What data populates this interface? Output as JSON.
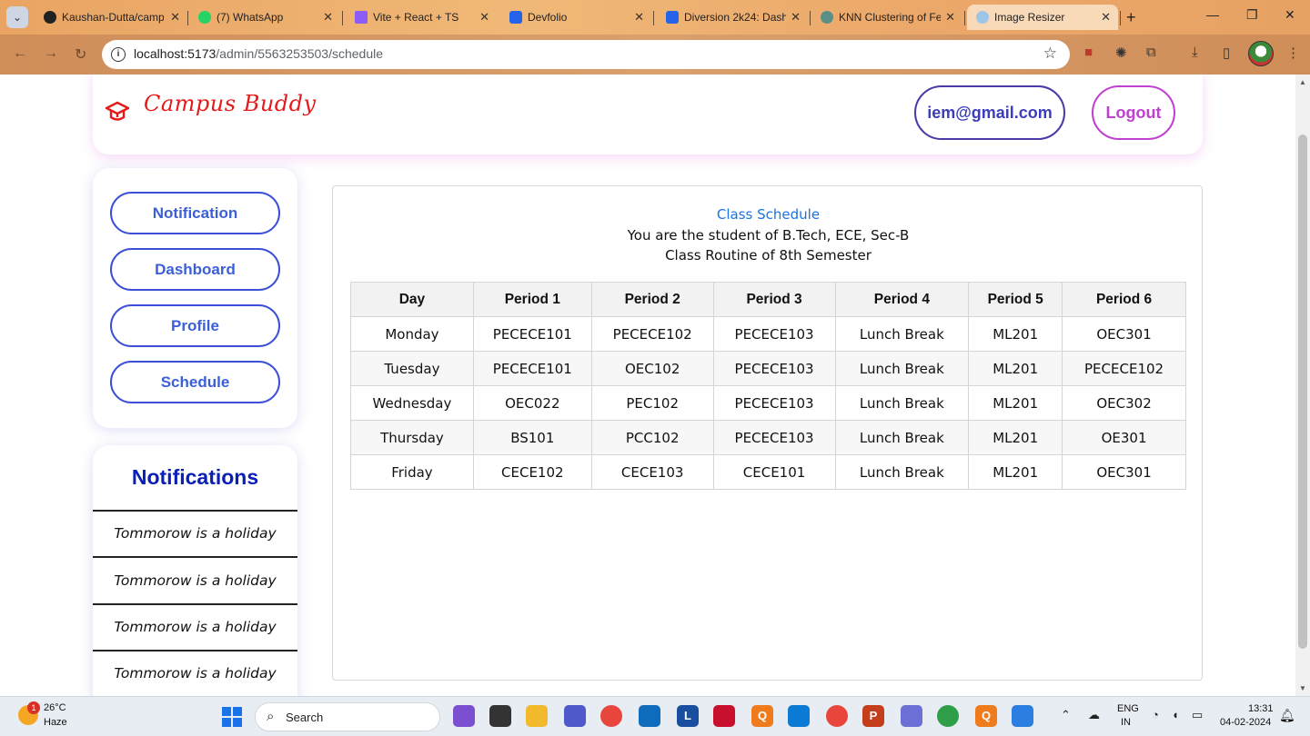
{
  "browser": {
    "tabs": [
      {
        "title": "Kaushan-Dutta/camp",
        "icon": "github-icon",
        "active": false
      },
      {
        "title": "(7) WhatsApp",
        "icon": "whatsapp-icon",
        "active": false
      },
      {
        "title": "Vite + React + TS",
        "icon": "vite-icon",
        "active": false
      },
      {
        "title": "Devfolio",
        "icon": "devfolio-icon",
        "active": false
      },
      {
        "title": "Diversion 2k24: Dash",
        "icon": "devfolio-icon",
        "active": false
      },
      {
        "title": "KNN Clustering of Fe",
        "icon": "openai-icon",
        "active": false
      },
      {
        "title": "Image Resizer",
        "icon": "globe-icon",
        "active": true
      }
    ],
    "url_host": "localhost:5173",
    "url_path": "/admin/5563253503/schedule"
  },
  "header": {
    "brand": "Campus Buddy",
    "email": "iem@gmail.com",
    "logout": "Logout",
    "brand_color": "#e51a1a"
  },
  "nav": {
    "items": [
      "Notification",
      "Dashboard",
      "Profile",
      "Schedule"
    ]
  },
  "notifications": {
    "title": "Notifications",
    "items": [
      "Tommorow is a holiday",
      "Tommorow is a holiday",
      "Tommorow is a holiday",
      "Tommorow is a holiday"
    ]
  },
  "schedule": {
    "title": "Class Schedule",
    "subtitle1": "You are the student of B.Tech, ECE, Sec-B",
    "subtitle2": "Class Routine of 8th Semester",
    "headers": [
      "Day",
      "Period 1",
      "Period 2",
      "Period 3",
      "Period 4",
      "Period 5",
      "Period 6"
    ],
    "rows": [
      [
        "Monday",
        "PECECE101",
        "PECECE102",
        "PECECE103",
        "Lunch Break",
        "ML201",
        "OEC301"
      ],
      [
        "Tuesday",
        "PECECE101",
        "OEC102",
        "PECECE103",
        "Lunch Break",
        "ML201",
        "PECECE102"
      ],
      [
        "Wednesday",
        "OEC022",
        "PEC102",
        "PECECE103",
        "Lunch Break",
        "ML201",
        "OEC302"
      ],
      [
        "Thursday",
        "BS101",
        "PCC102",
        "PECECE103",
        "Lunch Break",
        "ML201",
        "OE301"
      ],
      [
        "Friday",
        "CECE102",
        "CECE103",
        "CECE101",
        "Lunch Break",
        "ML201",
        "OEC301"
      ]
    ]
  },
  "taskbar": {
    "weather_temp": "26°C",
    "weather_desc": "Haze",
    "weather_badge": "1",
    "search": "Search",
    "lang1": "ENG",
    "lang2": "IN",
    "time": "13:31",
    "date": "04-02-2024"
  }
}
